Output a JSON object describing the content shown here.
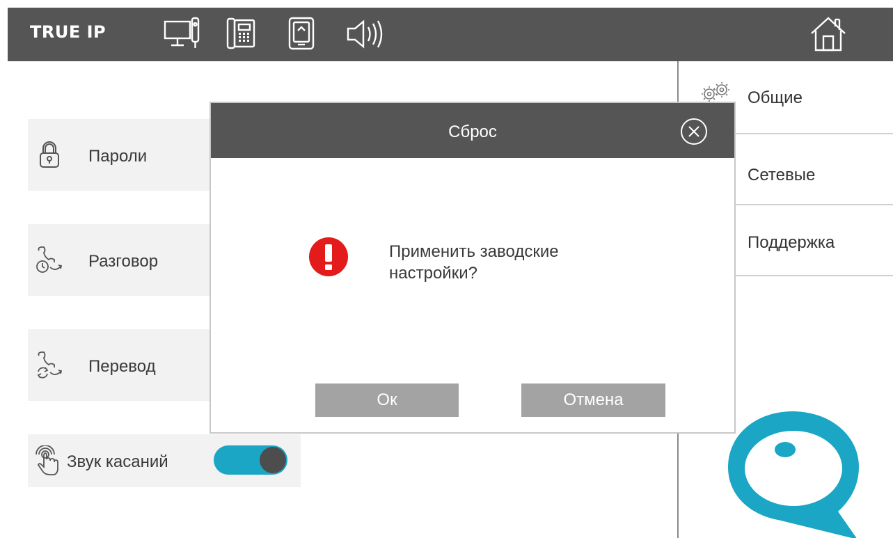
{
  "app": {
    "brand": "TRUE IP"
  },
  "topbar": {
    "icons": [
      "monitor-icon",
      "intercom-phone-icon",
      "sd-card-icon",
      "speaker-icon",
      "home-icon"
    ]
  },
  "menu": {
    "items": [
      {
        "label": "Пароли",
        "icon": "lock-icon"
      },
      {
        "label": "Разговор",
        "icon": "call-clock-icon"
      },
      {
        "label": "Перевод",
        "icon": "call-transfer-icon"
      }
    ],
    "touch_sound": {
      "label": "Звук касаний",
      "icon": "touch-icon",
      "enabled": true
    }
  },
  "right_menu": {
    "items": [
      {
        "label": "Общие",
        "icon": "gears-icon"
      },
      {
        "label": "Сетевые"
      },
      {
        "label": "Поддержка"
      }
    ]
  },
  "dialog": {
    "title": "Сброс",
    "message": "Применить заводские настройки?",
    "ok_label": "Ок",
    "cancel_label": "Отмена"
  },
  "colors": {
    "header": "#555555",
    "accent": "#1aa6c4",
    "warning": "#e31b1b",
    "button": "#a3a3a3",
    "panel": "#f2f2f2"
  }
}
